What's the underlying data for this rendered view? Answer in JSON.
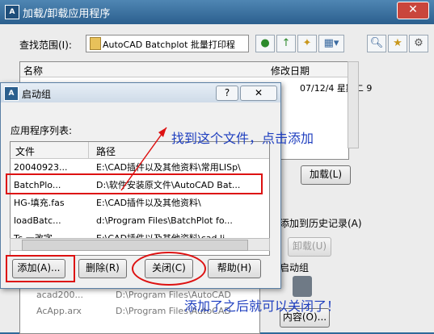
{
  "main": {
    "title": "加载/卸载应用程序",
    "lookin_label": "查找范围(I):",
    "lookin_value": "AutoCAD Batchplot 批量打印程",
    "col_name": "名称",
    "col_date": "修改日期",
    "date_value": "07/12/4 星期二 9",
    "load_button": "加载(L)",
    "history_label": "添加到历史记录(A)",
    "unload_button": "卸载(U)",
    "startup_label": "启动组",
    "contents_button": "内容(O)...",
    "bg_rows": [
      {
        "name": "acad200...",
        "path": "D:\\Program Files\\AutoCAD"
      },
      {
        "name": "AcApp.arx",
        "path": "D:\\Program Files\\AutoCAD"
      }
    ]
  },
  "startup": {
    "title": "启动组",
    "help_glyph": "?",
    "list_label": "应用程序列表:",
    "col_file": "文件",
    "col_path": "路径",
    "rows": [
      {
        "file": "20040923...",
        "path": "E:\\CAD插件以及其他资料\\常用LISp\\"
      },
      {
        "file": "BatchPlo...",
        "path": "D:\\软件安装原文件\\AutoCAD Bat..."
      },
      {
        "file": "HG-填充.fas",
        "path": "E:\\CAD插件以及其他资料\\"
      },
      {
        "file": "loadBatc...",
        "path": "d:\\Program Files\\BatchPlot fo..."
      },
      {
        "file": "Tc-一改字...",
        "path": "E:\\CAD插件以及其他资料\\cad li..."
      }
    ],
    "add_button": "添加(A)...",
    "remove_button": "删除(R)",
    "close_button": "关闭(C)",
    "help_button": "帮助(H)"
  },
  "annotations": {
    "top": "找到这个文件，点击添加",
    "bottom": "添加了之后就可以关闭了！"
  },
  "colors": {
    "annotation": "#1f3fbf",
    "highlight": "#dd1111"
  }
}
